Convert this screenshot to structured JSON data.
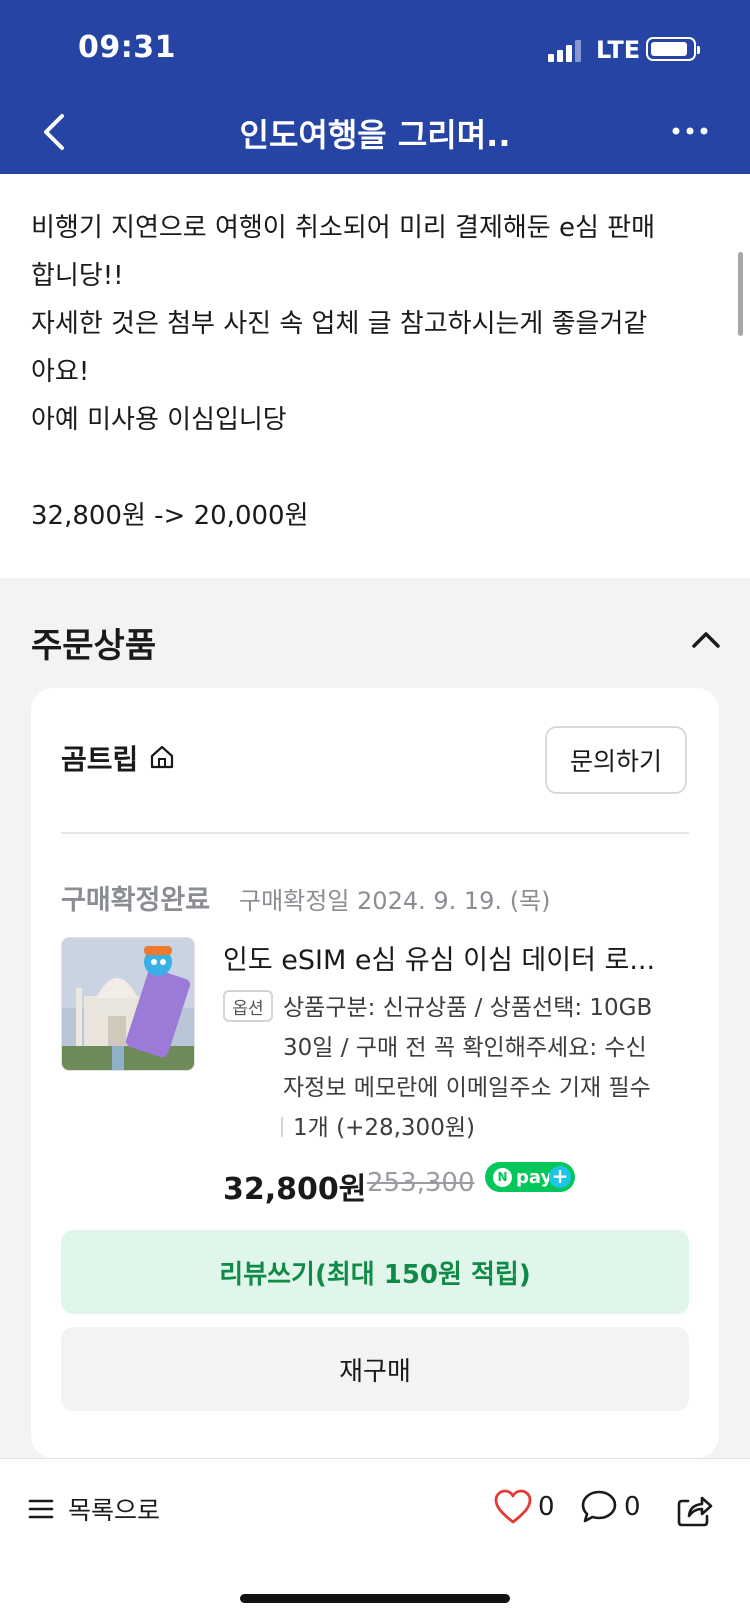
{
  "status_bar": {
    "time": "09:31",
    "network": "LTE"
  },
  "nav": {
    "title": "인도여행을 그리며.."
  },
  "post": {
    "lines": [
      "비행기 지연으로 여행이 취소되어 미리 결제해둔 e심 판매",
      "합니당!!",
      "자세한 것은 첨부 사진 속 업체 글 참고하시는게 좋을거같",
      "아요!",
      "아예 미사용 이심입니당",
      "",
      "32,800원 -> 20,000원"
    ]
  },
  "order": {
    "section_title": "주문상품",
    "seller": "곰트립",
    "inquiry_label": "문의하기",
    "status": "구매확정완료",
    "status_date": "구매확정일 2024. 9. 19. (목)",
    "product_name": "인도 eSIM e심 유심 이심 데이터 로...",
    "option_badge": "옵션",
    "option_lines": [
      "상품구분: 신규상품 / 상품선택: 10GB",
      "30일 / 구매 전 꼭 확인해주세요: 수신",
      "자정보 메모란에 이메일주소 기재 필수"
    ],
    "quantity": "1개 (+28,300원)",
    "price": "32,800원",
    "original_price": "253,300",
    "npay_label": "pay",
    "review_label": "리뷰쓰기(최대 150원 적립)",
    "rebuy_label": "재구매"
  },
  "bottom": {
    "list_label": "목록으로",
    "likes": "0",
    "comments": "0"
  },
  "colors": {
    "header_bg": "#2544a4",
    "review_bg": "#e1f6ea",
    "review_text": "#0f8a47",
    "npay_green": "#03c75a",
    "heart_red": "#e53935"
  }
}
